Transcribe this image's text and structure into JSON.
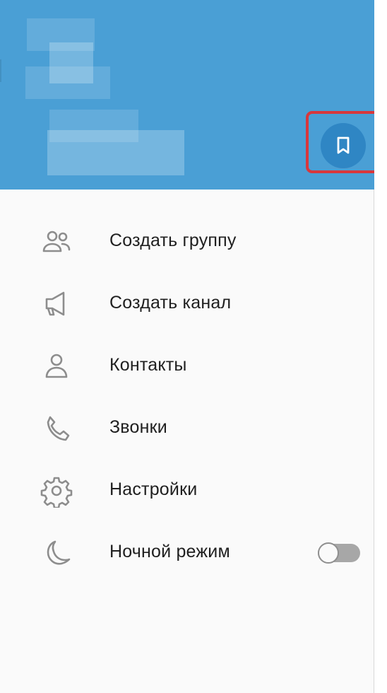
{
  "header": {
    "bookmark_button_icon": "bookmark-icon",
    "bookmark_highlight_color": "#d8373c",
    "background_color": "#4a9fd5"
  },
  "menu": {
    "items": [
      {
        "label": "Создать группу",
        "icon": "group-icon"
      },
      {
        "label": "Создать канал",
        "icon": "megaphone-icon"
      },
      {
        "label": "Контакты",
        "icon": "user-icon"
      },
      {
        "label": "Звонки",
        "icon": "phone-icon"
      },
      {
        "label": "Настройки",
        "icon": "gear-icon"
      },
      {
        "label": "Ночной режим",
        "icon": "moon-icon",
        "toggle_state": "off"
      }
    ]
  }
}
